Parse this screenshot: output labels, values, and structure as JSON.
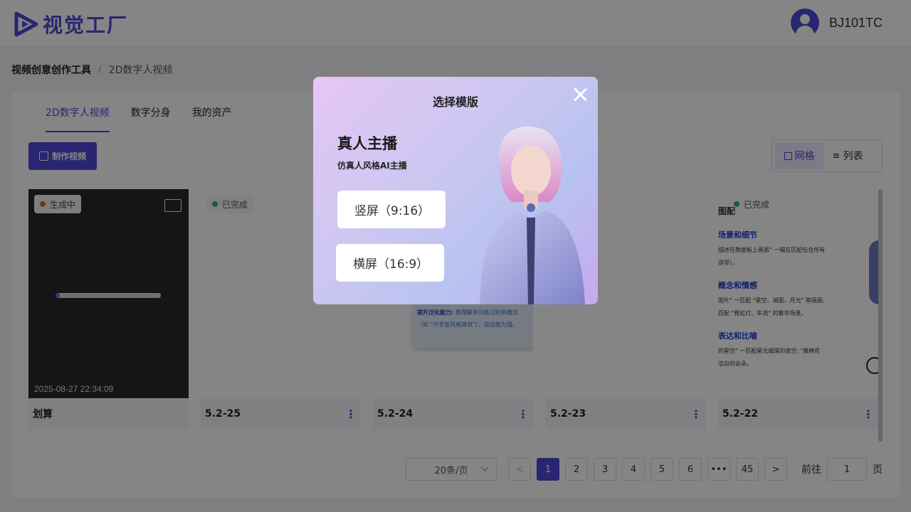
{
  "header": {
    "logo_text": "视觉工厂",
    "username": "BJ101TC"
  },
  "breadcrumb": {
    "root": "视频创意创作工具",
    "separator": "/",
    "current": "2D数字人视频"
  },
  "tabs": [
    {
      "label": "2D数字人视频",
      "active": true
    },
    {
      "label": "数字分身",
      "active": false
    },
    {
      "label": "我的资产",
      "active": false
    }
  ],
  "toolbar": {
    "make_video": "制作视频",
    "view_grid": "网格",
    "view_list": "列表"
  },
  "cards": [
    {
      "title": "划算",
      "status": "生成中",
      "time": "2025-08-27 22:34:09",
      "progress": 0.04
    },
    {
      "title": "5.2-25",
      "status": "已完成"
    },
    {
      "title": "5.2-24",
      "status": "",
      "snippet_heading": "提升泛化能力:",
      "snippet_line1": "推理解未训练过的新概念",
      "snippet_line2": "（如 \"元宇宙风格建筑\"），适应能力强。"
    },
    {
      "title": "5.2-23",
      "status": ""
    },
    {
      "title": "5.2-22",
      "status": "已完成",
      "doc_heading0": "图配",
      "doc_heading1": "场景和细节",
      "doc_line1": "描述在数据板上画面\" 一幅在匹配包含所有",
      "doc_line1b": "误导）。",
      "doc_heading2": "概念和情感",
      "doc_line2": "图片\" 一匹配 \"星空、湖面、月光\" 等画面;",
      "doc_line2b": "匹配 \"霓虹灯、车流\" 的繁华场景。",
      "doc_heading3": "表达和比喻",
      "doc_line3": "的星空\" 一匹配星光璀璨的夜空; \"像棉花",
      "doc_line3b": "洁白的云朵。"
    }
  ],
  "pagination": {
    "page_size": "20条/页",
    "prev": "<",
    "next": ">",
    "pages": [
      "1",
      "2",
      "3",
      "4",
      "5",
      "6",
      "•••",
      "45"
    ],
    "current_page": "1",
    "goto_label": "前往",
    "goto_value": "1",
    "goto_suffix": "页"
  },
  "modal": {
    "title": "选择模版",
    "heading": "真人主播",
    "subtitle": "仿真人风格AI主播",
    "option_portrait": "竖屏（9:16）",
    "option_landscape": "横屏（16:9）"
  },
  "colors": {
    "accent": "#4f47d6",
    "status_generating": "#e8623a",
    "status_done": "#2fb073"
  }
}
